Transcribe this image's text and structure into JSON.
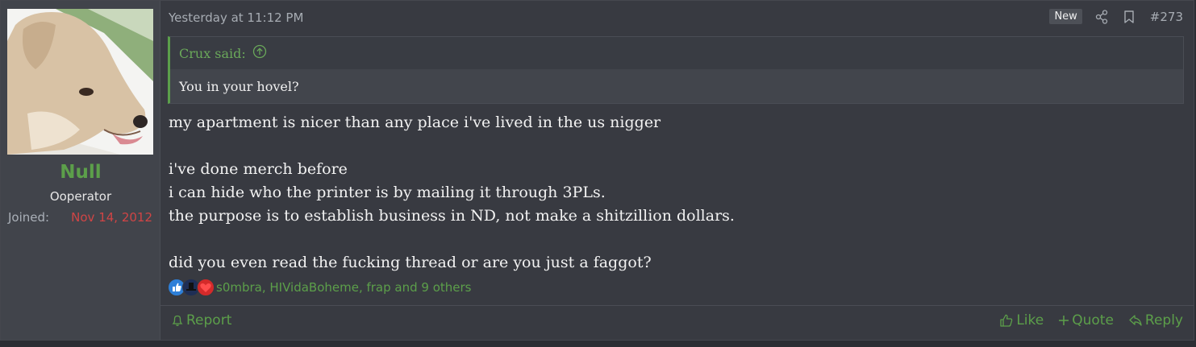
{
  "user": {
    "name": "Null",
    "title": "Ooperator",
    "joined_label": "Joined:",
    "joined_date": "Nov 14, 2012",
    "avatar_icon": "dog-avatar"
  },
  "post": {
    "timestamp": "Yesterday at 11:12 PM",
    "new_badge": "New",
    "number": "#273",
    "share_icon": "share-icon",
    "bookmark_icon": "bookmark-icon"
  },
  "quote": {
    "author_said": "Crux said:",
    "text": "You in your hovel?"
  },
  "message": {
    "lines": [
      "my apartment is nicer than any place i've lived in the us nigger",
      "",
      "i've done merch before",
      "i can hide who the printer is by mailing it through 3PLs.",
      "the purpose is to establish business in ND, not make a shitzillion dollars.",
      "",
      "did you even read the fucking thread or are you just a faggot?"
    ]
  },
  "reactions": {
    "text": "s0mbra, HIVidaBoheme, frap and 9 others",
    "icons": [
      "like-reaction-icon",
      "hat-reaction-icon",
      "heart-reaction-icon"
    ]
  },
  "footer": {
    "report": "Report",
    "like": "Like",
    "quote": "Quote",
    "reply": "Reply"
  },
  "colors": {
    "accent_green": "#5c9f4a",
    "joined_red": "#d04545",
    "background": "#383a41"
  }
}
